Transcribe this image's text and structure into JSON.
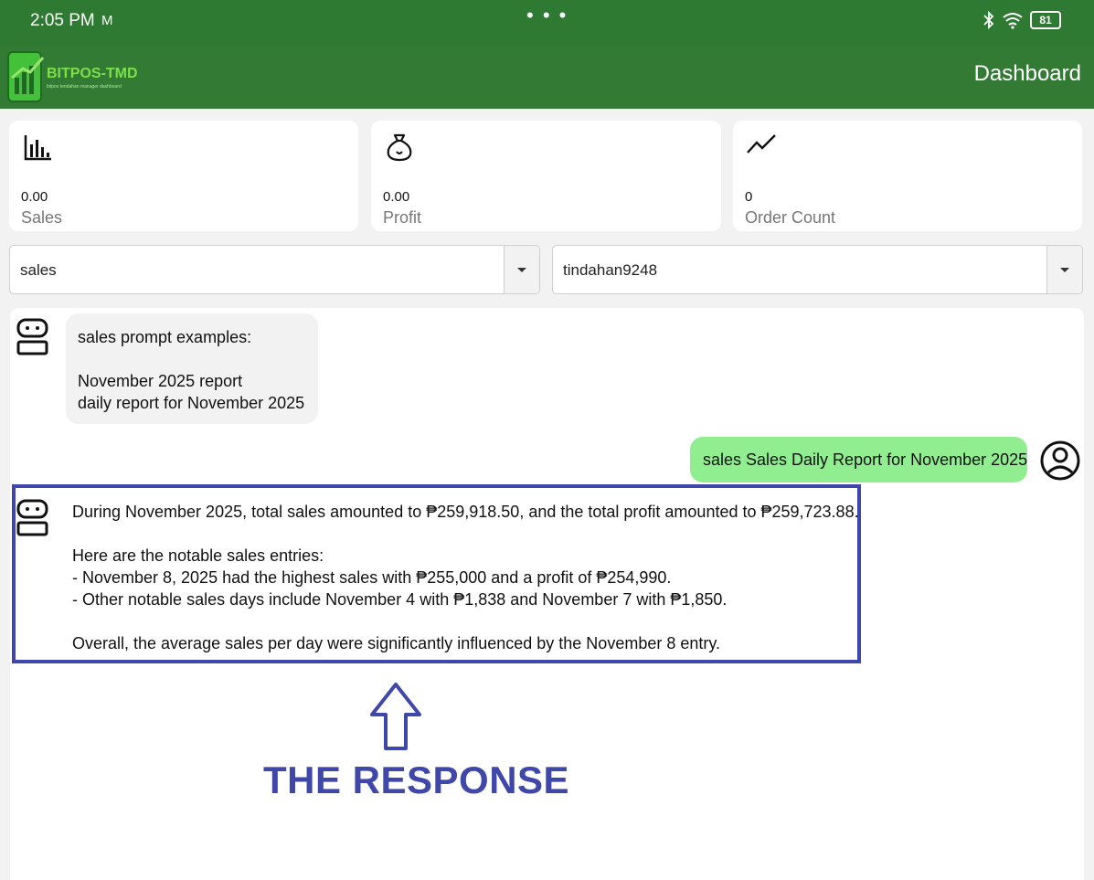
{
  "status_bar": {
    "time": "2:05 PM",
    "mail_indicator": "M",
    "center_dots": "• • •",
    "battery_level": "81",
    "icons": [
      "bluetooth-icon",
      "wifi-icon",
      "battery-icon"
    ]
  },
  "app_bar": {
    "logo_text": "BITPOS-TMD",
    "logo_subtext": "bitpos tendahan manager dashboard",
    "title": "Dashboard"
  },
  "stats": [
    {
      "icon": "bar-chart-icon",
      "value": "0.00",
      "label": "Sales"
    },
    {
      "icon": "money-bag-icon",
      "value": "0.00",
      "label": "Profit"
    },
    {
      "icon": "trend-line-icon",
      "value": "0",
      "label": "Order Count"
    }
  ],
  "filters": {
    "category": "sales",
    "store": "tindahan9248"
  },
  "chat": {
    "bot_intro": {
      "line1": "sales prompt examples:",
      "line2": "November 2025 report",
      "line3": "daily report for November 2025"
    },
    "user_message": "sales Sales Daily Report for November 2025",
    "bot_response": {
      "p1": "During November 2025, total sales amounted to ₱259,918.50, and the total profit amounted to ₱259,723.88.",
      "p2": "Here are the notable sales entries:",
      "p3": "- November 8, 2025 had the highest sales with ₱255,000 and a profit of ₱254,990.",
      "p4": "- Other notable sales days include November 4 with ₱1,838 and November 7 with ₱1,850.",
      "p5": "Overall, the average sales per day were significantly influenced by the November 8 entry."
    }
  },
  "annotation": {
    "label": "THE RESPONSE",
    "color": "#3f48a8",
    "icon": "up-arrow-icon"
  },
  "colors": {
    "status_bar": "#2f7a32",
    "app_bar": "#337a35",
    "user_bubble": "#90ee90",
    "bot_bubble": "#f2f2f2"
  }
}
